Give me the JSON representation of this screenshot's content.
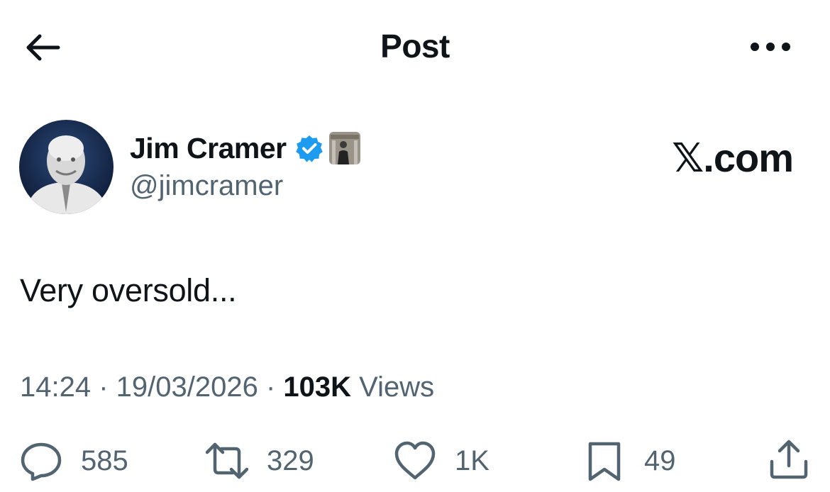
{
  "header": {
    "title": "Post"
  },
  "author": {
    "name": "Jim Cramer",
    "handle": "@jimcramer",
    "verified_color": "#1d9bf0"
  },
  "brand": "𝕏.com",
  "post": {
    "text": "Very oversold..."
  },
  "meta": {
    "time": "14:24",
    "separator": " · ",
    "date": "19/03/2026",
    "views_count": "103K",
    "views_label": " Views"
  },
  "actions": {
    "replies": "585",
    "reposts": "329",
    "likes": "1K",
    "bookmarks": "49"
  },
  "icons": [
    "back-arrow-icon",
    "more-icon",
    "verified-badge-icon",
    "reply-icon",
    "repost-icon",
    "like-icon",
    "bookmark-icon",
    "share-icon"
  ]
}
